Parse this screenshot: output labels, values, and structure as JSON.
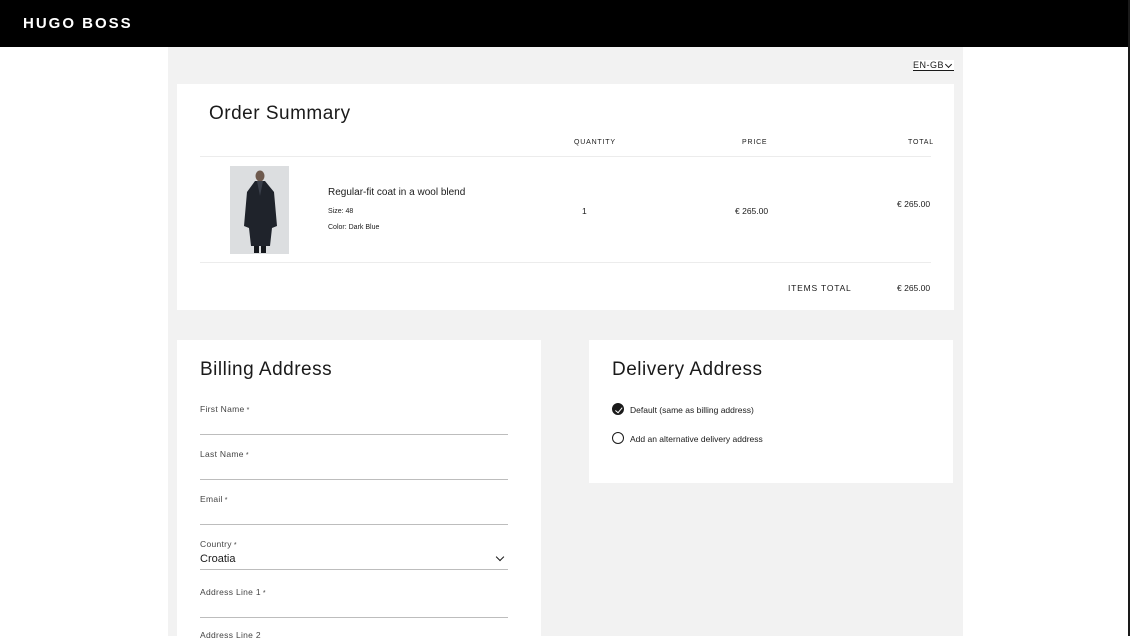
{
  "header": {
    "logo_text": "HUGO BOSS"
  },
  "language": {
    "selected": "EN-GB"
  },
  "order_summary": {
    "title": "Order Summary",
    "columns": {
      "quantity": "QUANTITY",
      "price": "PRICE",
      "total": "TOTAL"
    },
    "item": {
      "name": "Regular-fit coat in a wool blend",
      "size": "Size: 48",
      "color": "Color: Dark Blue",
      "quantity": "1",
      "price": "€ 265.00",
      "total": "€ 265.00"
    },
    "items_total_label": "ITEMS TOTAL",
    "items_total_value": "€ 265.00"
  },
  "billing": {
    "title": "Billing Address",
    "fields": {
      "first_name": {
        "label": "First Name",
        "value": ""
      },
      "last_name": {
        "label": "Last Name",
        "value": ""
      },
      "email": {
        "label": "Email",
        "value": ""
      },
      "country": {
        "label": "Country",
        "value": "Croatia"
      },
      "address1": {
        "label": "Address Line 1",
        "value": ""
      },
      "address2": {
        "label": "Address Line 2",
        "value": ""
      }
    },
    "required_marker": "*"
  },
  "delivery": {
    "title": "Delivery Address",
    "options": [
      {
        "label": "Default (same as billing address)",
        "selected": true
      },
      {
        "label": "Add an alternative delivery address",
        "selected": false
      }
    ]
  },
  "colors": {
    "topbar": "#000000",
    "page_bg": "#f2f2f2",
    "card_bg": "#ffffff",
    "text": "#1a1a1a"
  }
}
